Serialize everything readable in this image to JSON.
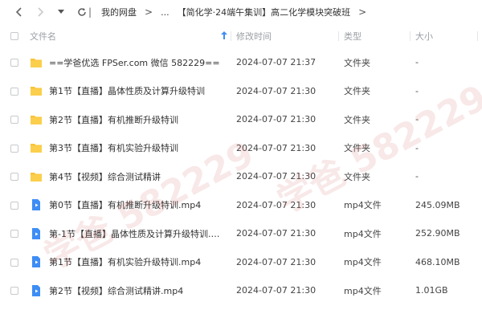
{
  "nav": {
    "back_icon": "chevron-left-icon",
    "forward_icon": "chevron-right-icon",
    "dropdown_icon": "caret-down-icon",
    "refresh_icon": "refresh-icon",
    "separator": "|"
  },
  "breadcrumb": {
    "root": "我的网盘",
    "sep": ">",
    "ellipsis": "...",
    "current": "【简化学·24端午集训】高二化学模块突破班",
    "trailing": ">"
  },
  "table": {
    "headers": {
      "name": "文件名",
      "time": "修改时间",
      "type": "类型",
      "size": "大小"
    },
    "sort_icon": "arrow-up-icon",
    "rows": [
      {
        "name": "==学爸优选 FPSer.com 微信 582229==",
        "time": "2024-07-07 21:37",
        "type": "文件夹",
        "size": "-",
        "icon": "folder"
      },
      {
        "name": "第1节【直播】晶体性质及计算升级特训",
        "time": "2024-07-07 21:30",
        "type": "文件夹",
        "size": "-",
        "icon": "folder"
      },
      {
        "name": "第2节【直播】有机推断升级特训",
        "time": "2024-07-07 21:30",
        "type": "文件夹",
        "size": "-",
        "icon": "folder"
      },
      {
        "name": "第3节【直播】有机实验升级特训",
        "time": "2024-07-07 21:30",
        "type": "文件夹",
        "size": "-",
        "icon": "folder"
      },
      {
        "name": "第4节【视频】综合测试精讲",
        "time": "2024-07-07 21:30",
        "type": "文件夹",
        "size": "-",
        "icon": "folder"
      },
      {
        "name": "第0节【直播】有机推断升级特训.mp4",
        "time": "2024-07-07 21:30",
        "type": "mp4文件",
        "size": "245.09MB",
        "icon": "video"
      },
      {
        "name": "第-1节【直播】晶体性质及计算升级特训.m...",
        "time": "2024-07-07 21:30",
        "type": "mp4文件",
        "size": "252.90MB",
        "icon": "video"
      },
      {
        "name": "第1节【直播】有机实验升级特训.mp4",
        "time": "2024-07-07 21:30",
        "type": "mp4文件",
        "size": "468.10MB",
        "icon": "video"
      },
      {
        "name": "第2节【视频】综合测试精讲.mp4",
        "time": "2024-07-07 21:30",
        "type": "mp4文件",
        "size": "1.01GB",
        "icon": "video"
      }
    ]
  },
  "colors": {
    "folder": "#f8c43a",
    "video": "#3d8df5",
    "accent": "#3d8df5"
  }
}
